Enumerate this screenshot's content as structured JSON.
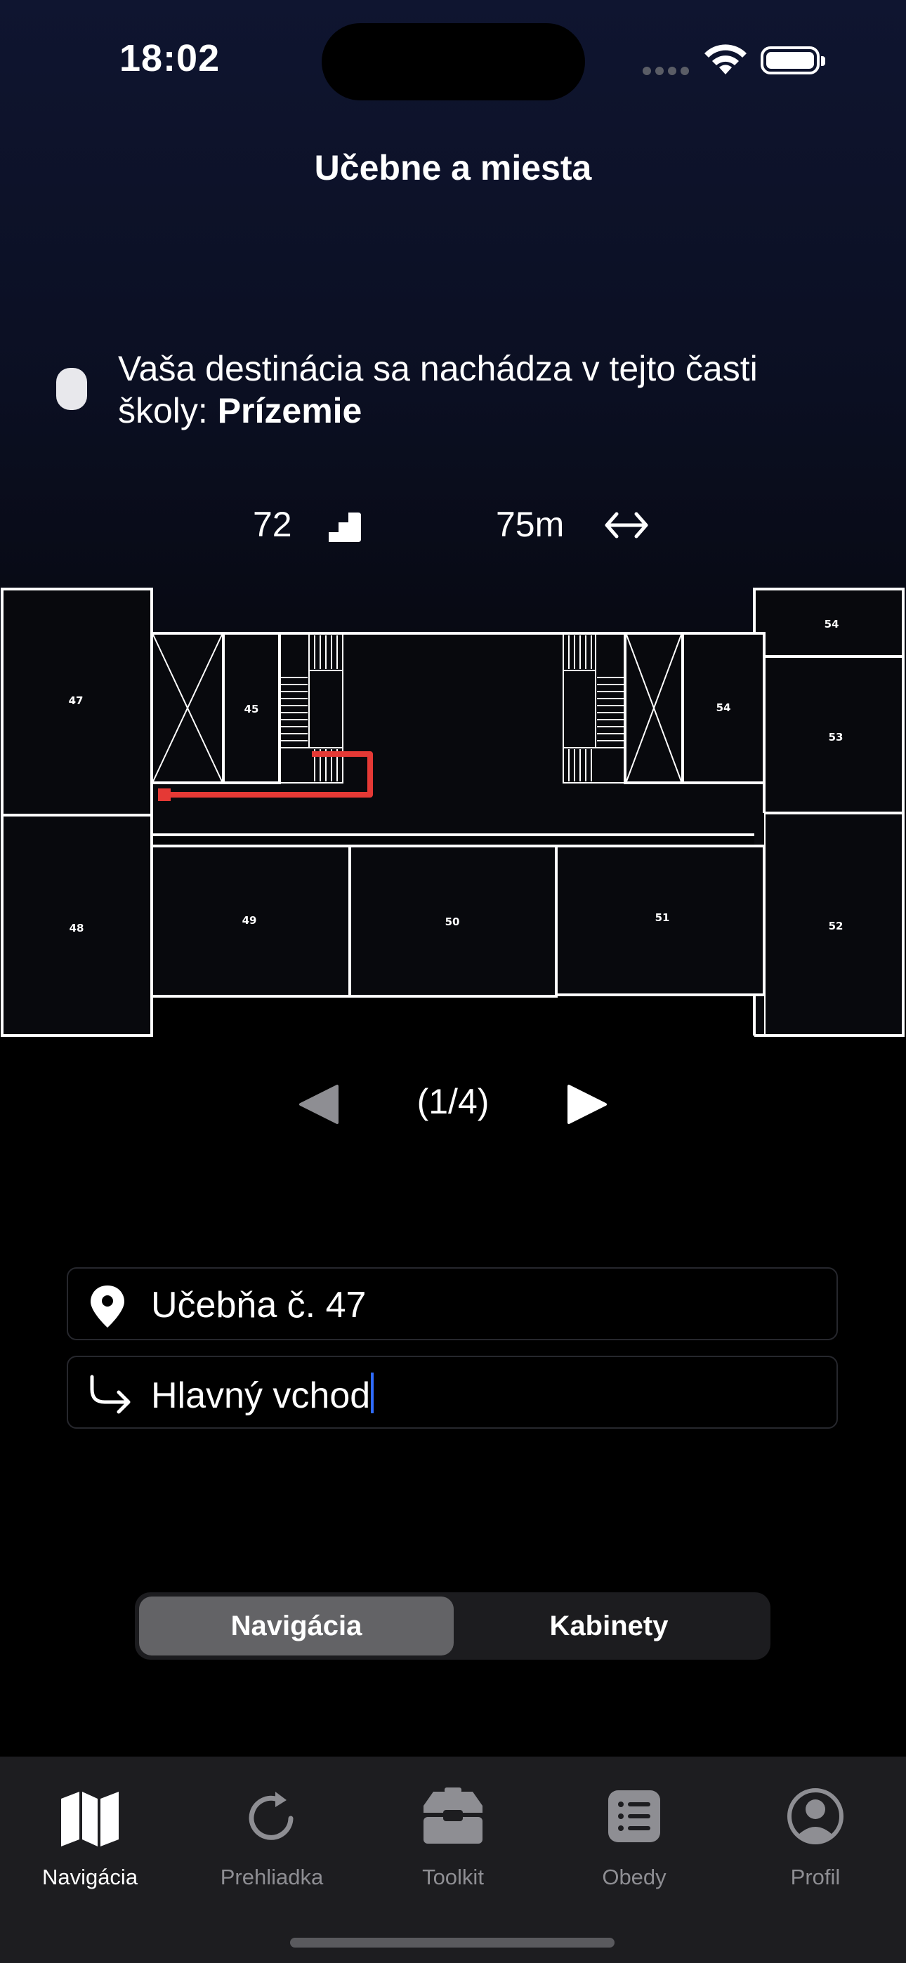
{
  "status_bar": {
    "time": "18:02"
  },
  "header": {
    "title": "Učebne a miesta"
  },
  "notice": {
    "text": "Vaša destinácia sa nachádza v tejto časti školy: ",
    "floor": "Prízemie"
  },
  "stats": {
    "stairs": "72",
    "distance": "75m"
  },
  "floorplan": {
    "rooms": {
      "r47": "47",
      "r48": "48",
      "r45": "45",
      "r54_left": "54",
      "r54_top": "54",
      "r53": "53",
      "r49": "49",
      "r50": "50",
      "r51": "51",
      "r52": "52"
    },
    "route_color": "#e53935"
  },
  "pager": {
    "label": "(1/4)"
  },
  "destination": {
    "value": "Učebňa č. 47",
    "icon": "location-pin-icon"
  },
  "start": {
    "value": "Hlavný vchod",
    "icon": "turn-right-arrow-icon"
  },
  "segmented": {
    "options": [
      "Navigácia",
      "Kabinety"
    ],
    "selected": "Navigácia"
  },
  "tabbar": {
    "items": [
      {
        "label": "Navigácia",
        "icon": "map-icon",
        "active": true
      },
      {
        "label": "Prehliadka",
        "icon": "refresh-icon",
        "active": false
      },
      {
        "label": "Toolkit",
        "icon": "toolbox-icon",
        "active": false
      },
      {
        "label": "Obedy",
        "icon": "list-icon",
        "active": false
      },
      {
        "label": "Profil",
        "icon": "person-circle-icon",
        "active": false
      }
    ]
  }
}
